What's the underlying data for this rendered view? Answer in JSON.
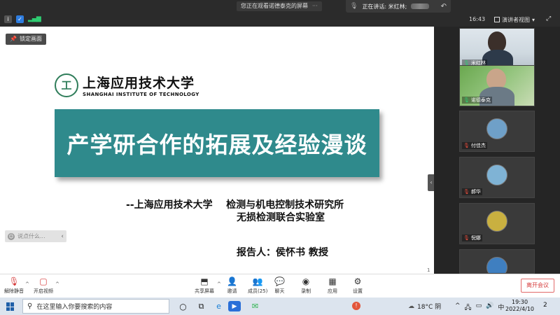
{
  "topbar": {
    "viewing_text": "您正在观看诺德泰克的屏幕",
    "viewing_more": "···",
    "speaking_text": "正在讲话: 米红林;",
    "clock": "16:43",
    "view_label": "演讲者视图"
  },
  "slide": {
    "lock_label": "锁定画面",
    "logo_mark": "工",
    "logo_cn": "上海应用技术大学",
    "logo_en": "SHANGHAI INSTITUTE OF TECHNOLOGY",
    "title": "产学研合作的拓展及经验漫谈",
    "affiliation": "--上海应用技术大学    检测与机电控制技术研究所",
    "lab": "无损检测联合实验室",
    "reporter": "报告人：侯怀书 教授",
    "page_number": "1",
    "chat_placeholder": "说点什么..."
  },
  "participants": [
    {
      "name": "米红林",
      "type": "video",
      "mic": "on"
    },
    {
      "name": "诺德泰克",
      "type": "video",
      "mic": "on"
    },
    {
      "name": "付佳杰",
      "type": "avatar",
      "mic": "off",
      "color": "#6fa0c8"
    },
    {
      "name": "郝华",
      "type": "avatar",
      "mic": "off",
      "color": "#7fb3d5"
    },
    {
      "name": "倪娜",
      "type": "avatar",
      "mic": "off",
      "color": "#c9b040"
    },
    {
      "name": "",
      "type": "avatar",
      "mic": "off",
      "color": "#3f7fc0"
    }
  ],
  "toolbar": {
    "mute_label": "解除静音",
    "video_label": "开启视频",
    "share_label": "共享屏幕",
    "invite_label": "邀请",
    "members_label": "成员(25)",
    "chat_label": "聊天",
    "record_label": "录制",
    "apps_label": "应用",
    "settings_label": "设置",
    "leave_label": "离开会议"
  },
  "taskbar": {
    "search_placeholder": "在这里输入你要搜索的内容",
    "meeting_app": "▶",
    "weather": "18°C 阴",
    "ime": "中",
    "time": "19:30",
    "date": "2022/4/10",
    "notifications": "2"
  },
  "colors": {
    "banner": "#2f8a8c",
    "accent_red": "#d63b3b",
    "mic_on": "#2ecc71"
  }
}
